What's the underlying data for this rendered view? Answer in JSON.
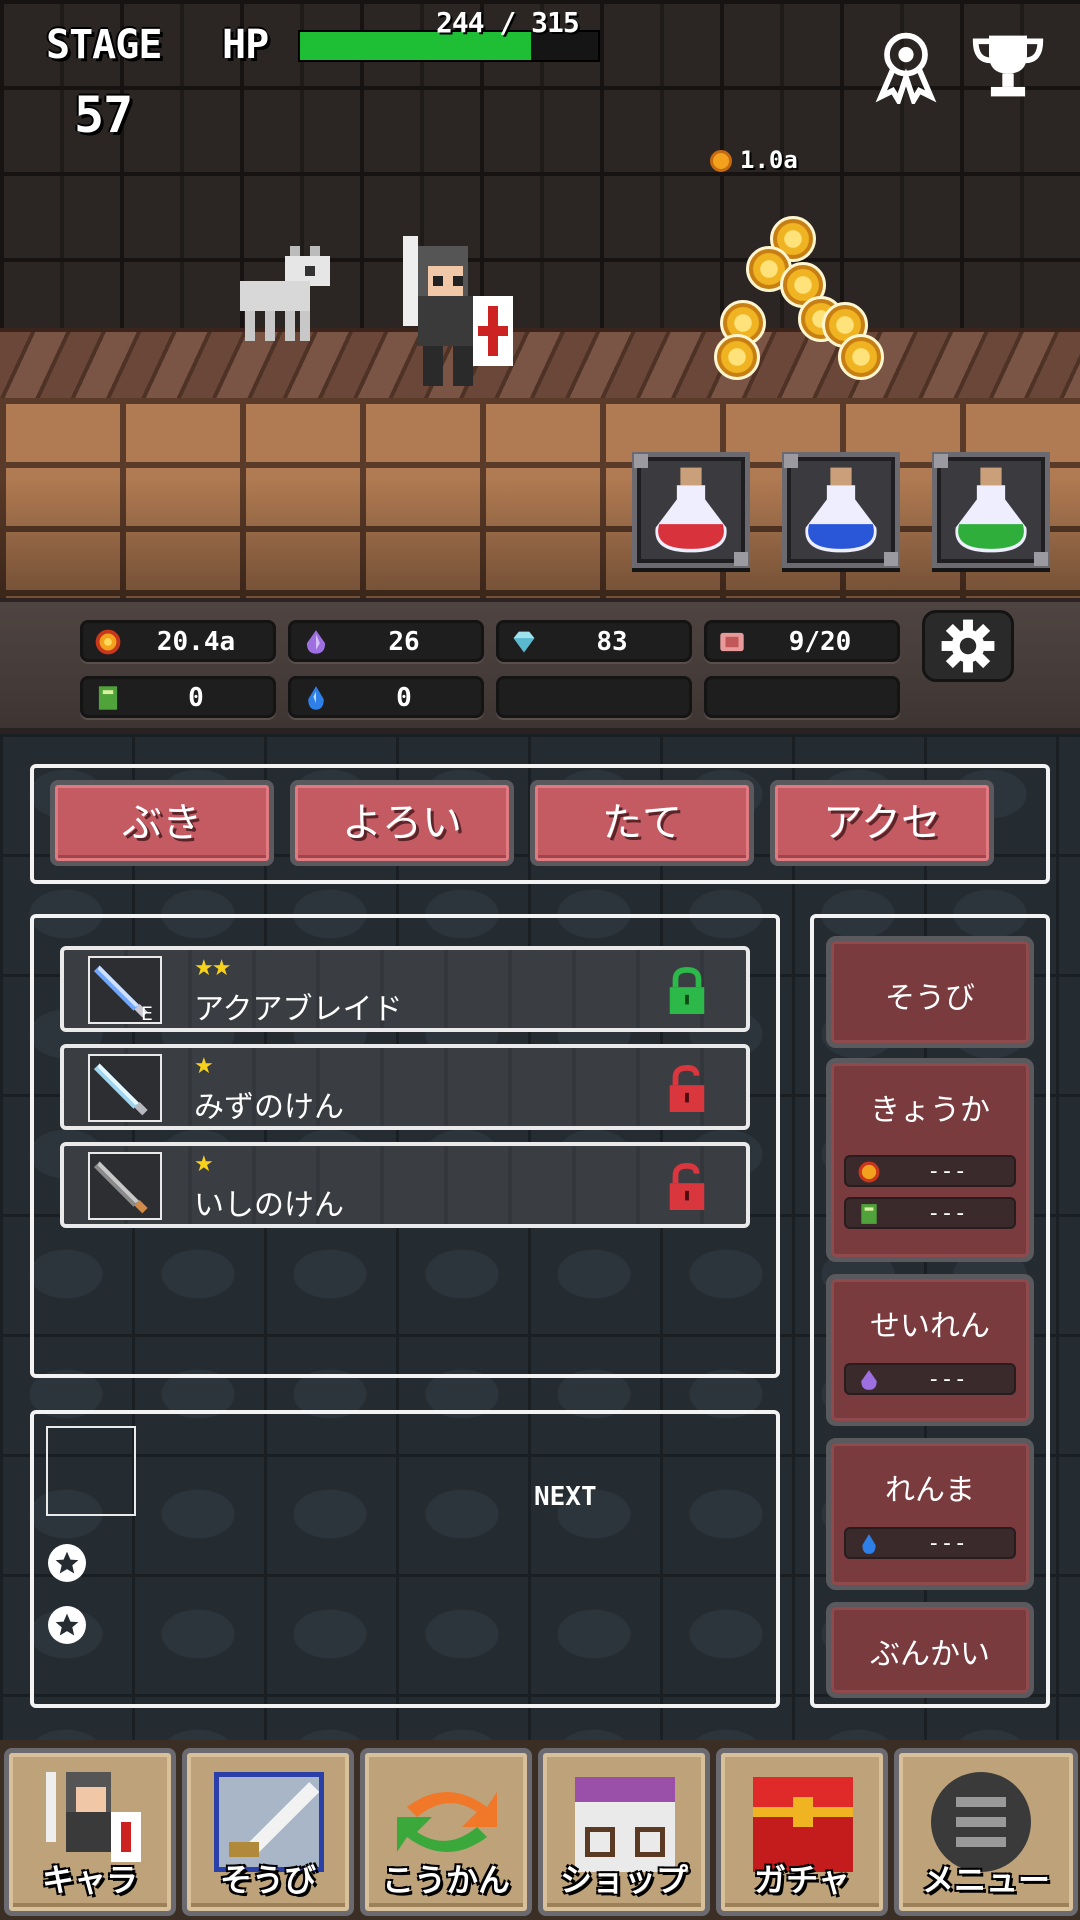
{
  "hud": {
    "stage_label": "STAGE",
    "stage_number": "57",
    "hp_label": "HP",
    "hp_text": "244 / 315",
    "hp_fraction": 0.775,
    "coin_rate": "1.0a"
  },
  "resources": {
    "coin": "20.4a",
    "purple_gem": "26",
    "diamond": "83",
    "ticket": "9/20",
    "book": "0",
    "blue_drop": "0"
  },
  "tabs": [
    "ぶき",
    "よろい",
    "たて",
    "アクセ"
  ],
  "items": [
    {
      "stars": "★★",
      "name": "アクアブレイド",
      "locked": true,
      "equipped_mark": "E"
    },
    {
      "stars": "★",
      "name": "みずのけん",
      "locked": false,
      "equipped_mark": ""
    },
    {
      "stars": "★",
      "name": "いしのけん",
      "locked": false,
      "equipped_mark": ""
    }
  ],
  "detail": {
    "next_label": "NEXT"
  },
  "actions": {
    "equip": "そうび",
    "upgrade": "きょうか",
    "upgrade_cost_coin": "---",
    "upgrade_cost_book": "---",
    "refine": "せいれん",
    "refine_cost": "---",
    "forge": "れんま",
    "forge_cost": "---",
    "dismantle": "ぶんかい"
  },
  "nav": {
    "chara": "キャラ",
    "equip": "そうび",
    "exchange": "こうかん",
    "shop": "ショップ",
    "gacha": "ガチャ",
    "menu": "メニュー"
  },
  "colors": {
    "hp_green": "#1fbf35",
    "tab_red": "#c45a62",
    "action_red": "#7a3b3f",
    "lock_green": "#2db84a",
    "lock_red": "#d9363e",
    "star_yellow": "#f7d21c"
  },
  "icons": {
    "badge": "ribbon-badge-icon",
    "trophy": "trophy-icon",
    "settings": "gear-icon"
  }
}
